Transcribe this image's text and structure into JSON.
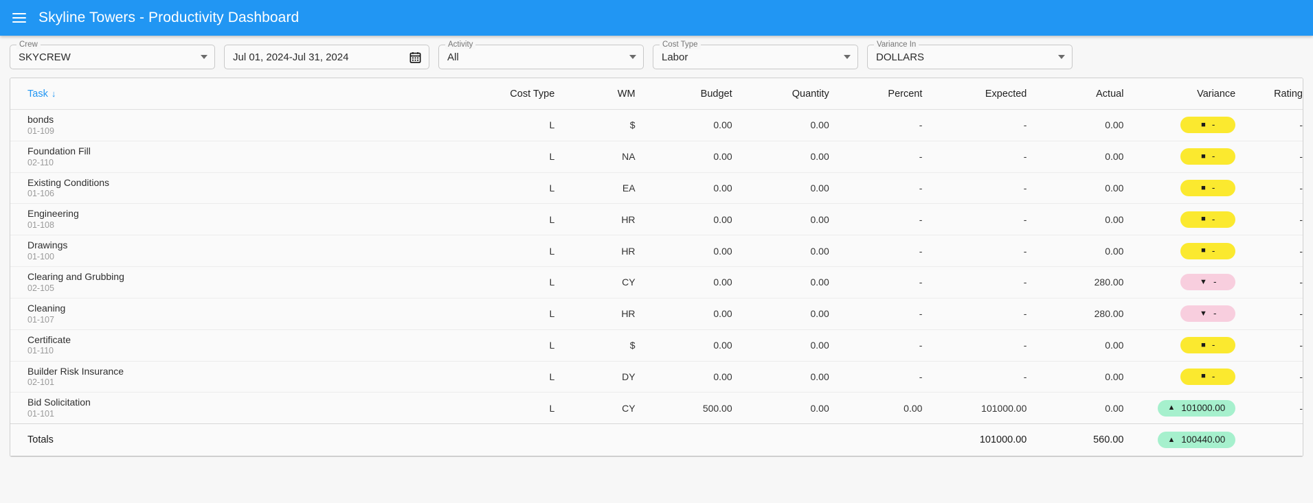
{
  "appbar": {
    "menu_icon": "hamburger-menu-icon",
    "title": "Skyline Towers - Productivity Dashboard",
    "bg_color": "#2196f3"
  },
  "filters": [
    {
      "key": "crew",
      "legend": "Crew",
      "value": "SKYCREW",
      "control": "select",
      "icon": "chevron-down-icon"
    },
    {
      "key": "daterange",
      "legend": "",
      "value": "Jul 01, 2024-Jul 31, 2024",
      "control": "datepicker",
      "icon": "calendar-icon"
    },
    {
      "key": "activity",
      "legend": "Activity",
      "value": "All",
      "control": "select",
      "icon": "chevron-down-icon"
    },
    {
      "key": "costtype",
      "legend": "Cost Type",
      "value": "Labor",
      "control": "select",
      "icon": "chevron-down-icon"
    },
    {
      "key": "variance",
      "legend": "Variance In",
      "value": "DOLLARS",
      "control": "select",
      "icon": "chevron-down-icon"
    }
  ],
  "table": {
    "sort_column": "Task",
    "sort_direction_icon": "↓",
    "headers": {
      "task": "Task",
      "cost_type": "Cost Type",
      "wm": "WM",
      "budget": "Budget",
      "quantity": "Quantity",
      "percent": "Percent",
      "expected": "Expected",
      "actual": "Actual",
      "variance": "Variance",
      "rating": "Rating"
    },
    "rows": [
      {
        "task": "bonds",
        "code": "01-109",
        "cost_type": "L",
        "wm": "$",
        "budget": "0.00",
        "quantity": "0.00",
        "percent": "-",
        "expected": "-",
        "actual": "0.00",
        "variance": {
          "value": "-",
          "state": "flat",
          "symbol": "■"
        },
        "rating": "-"
      },
      {
        "task": "Foundation Fill",
        "code": "02-110",
        "cost_type": "L",
        "wm": "NA",
        "budget": "0.00",
        "quantity": "0.00",
        "percent": "-",
        "expected": "-",
        "actual": "0.00",
        "variance": {
          "value": "-",
          "state": "flat",
          "symbol": "■"
        },
        "rating": "-"
      },
      {
        "task": "Existing Conditions",
        "code": "01-106",
        "cost_type": "L",
        "wm": "EA",
        "budget": "0.00",
        "quantity": "0.00",
        "percent": "-",
        "expected": "-",
        "actual": "0.00",
        "variance": {
          "value": "-",
          "state": "flat",
          "symbol": "■"
        },
        "rating": "-"
      },
      {
        "task": "Engineering",
        "code": "01-108",
        "cost_type": "L",
        "wm": "HR",
        "budget": "0.00",
        "quantity": "0.00",
        "percent": "-",
        "expected": "-",
        "actual": "0.00",
        "variance": {
          "value": "-",
          "state": "flat",
          "symbol": "■"
        },
        "rating": "-"
      },
      {
        "task": "Drawings",
        "code": "01-100",
        "cost_type": "L",
        "wm": "HR",
        "budget": "0.00",
        "quantity": "0.00",
        "percent": "-",
        "expected": "-",
        "actual": "0.00",
        "variance": {
          "value": "-",
          "state": "flat",
          "symbol": "■"
        },
        "rating": "-"
      },
      {
        "task": "Clearing and Grubbing",
        "code": "02-105",
        "cost_type": "L",
        "wm": "CY",
        "budget": "0.00",
        "quantity": "0.00",
        "percent": "-",
        "expected": "-",
        "actual": "280.00",
        "variance": {
          "value": "-",
          "state": "down",
          "symbol": "▼"
        },
        "rating": "-"
      },
      {
        "task": "Cleaning",
        "code": "01-107",
        "cost_type": "L",
        "wm": "HR",
        "budget": "0.00",
        "quantity": "0.00",
        "percent": "-",
        "expected": "-",
        "actual": "280.00",
        "variance": {
          "value": "-",
          "state": "down",
          "symbol": "▼"
        },
        "rating": "-"
      },
      {
        "task": "Certificate",
        "code": "01-110",
        "cost_type": "L",
        "wm": "$",
        "budget": "0.00",
        "quantity": "0.00",
        "percent": "-",
        "expected": "-",
        "actual": "0.00",
        "variance": {
          "value": "-",
          "state": "flat",
          "symbol": "■"
        },
        "rating": "-"
      },
      {
        "task": "Builder Risk Insurance",
        "code": "02-101",
        "cost_type": "L",
        "wm": "DY",
        "budget": "0.00",
        "quantity": "0.00",
        "percent": "-",
        "expected": "-",
        "actual": "0.00",
        "variance": {
          "value": "-",
          "state": "flat",
          "symbol": "■"
        },
        "rating": "-"
      },
      {
        "task": "Bid Solicitation",
        "code": "01-101",
        "cost_type": "L",
        "wm": "CY",
        "budget": "500.00",
        "quantity": "0.00",
        "percent": "0.00",
        "expected": "101000.00",
        "actual": "0.00",
        "variance": {
          "value": "101000.00",
          "state": "up",
          "symbol": "▲"
        },
        "rating": "-"
      }
    ],
    "totals": {
      "label": "Totals",
      "cost_type": "",
      "wm": "",
      "budget": "",
      "quantity": "",
      "percent": "",
      "expected": "101000.00",
      "actual": "560.00",
      "variance": {
        "value": "100440.00",
        "state": "up",
        "symbol": "▲"
      },
      "rating": ""
    }
  },
  "colors": {
    "accent": "#2196f3",
    "badge_flat": "#fbe92f",
    "badge_down": "#f8cede",
    "badge_up": "#a6f0cd"
  }
}
